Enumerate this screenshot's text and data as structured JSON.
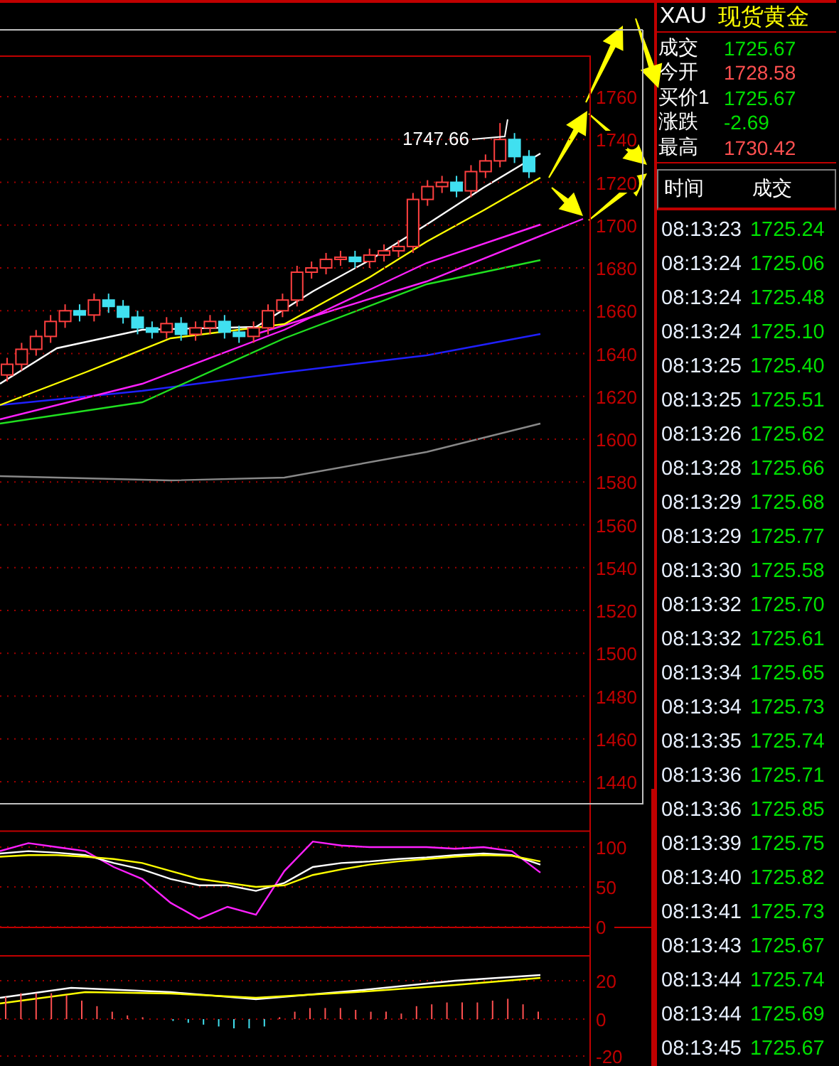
{
  "chart": {
    "high_label": "1747.66",
    "price_chart": {
      "chart_data": {
        "type": "candlestick",
        "ylim": [
          1440,
          1760
        ],
        "grid": true,
        "yticks": [
          1760,
          1740,
          1720,
          1700,
          1680,
          1660,
          1640,
          1620,
          1600,
          1580,
          1560,
          1540,
          1520,
          1500,
          1480,
          1460,
          1440
        ],
        "ohlc": [
          [
            1630,
            1638,
            1627,
            1635
          ],
          [
            1635,
            1645,
            1632,
            1642
          ],
          [
            1642,
            1651,
            1639,
            1648
          ],
          [
            1648,
            1658,
            1645,
            1655
          ],
          [
            1655,
            1663,
            1652,
            1660
          ],
          [
            1660,
            1663,
            1655,
            1658
          ],
          [
            1658,
            1668,
            1655,
            1665
          ],
          [
            1665,
            1668,
            1659,
            1662
          ],
          [
            1662,
            1665,
            1654,
            1657
          ],
          [
            1657,
            1660,
            1649,
            1652
          ],
          [
            1652,
            1655,
            1647,
            1650
          ],
          [
            1650,
            1657,
            1647,
            1654
          ],
          [
            1654,
            1657,
            1646,
            1649
          ],
          [
            1649,
            1655,
            1646,
            1652
          ],
          [
            1652,
            1658,
            1649,
            1655
          ],
          [
            1655,
            1658,
            1647,
            1650
          ],
          [
            1650,
            1653,
            1645,
            1648
          ],
          [
            1648,
            1655,
            1645,
            1652
          ],
          [
            1652,
            1663,
            1649,
            1660
          ],
          [
            1660,
            1668,
            1657,
            1665
          ],
          [
            1665,
            1681,
            1662,
            1678
          ],
          [
            1678,
            1683,
            1675,
            1680
          ],
          [
            1680,
            1687,
            1677,
            1684
          ],
          [
            1684,
            1688,
            1681,
            1685
          ],
          [
            1685,
            1688,
            1680,
            1683
          ],
          [
            1683,
            1689,
            1680,
            1686
          ],
          [
            1686,
            1691,
            1683,
            1688
          ],
          [
            1688,
            1693,
            1685,
            1690
          ],
          [
            1690,
            1715,
            1687,
            1712
          ],
          [
            1712,
            1721,
            1709,
            1718
          ],
          [
            1718,
            1723,
            1715,
            1720
          ],
          [
            1720,
            1723,
            1713,
            1716
          ],
          [
            1716,
            1728,
            1713,
            1725
          ],
          [
            1725,
            1733,
            1722,
            1730
          ],
          [
            1730,
            1747.66,
            1727,
            1740
          ],
          [
            1740,
            1743,
            1729,
            1732
          ],
          [
            1732,
            1735,
            1722,
            1725
          ]
        ]
      }
    },
    "kdj_chart": {
      "chart_data": {
        "type": "line",
        "ylim": [
          0,
          120
        ],
        "grid": true,
        "yticks": [
          100,
          50,
          0
        ],
        "series": [
          {
            "color": "#ff20ff",
            "values": [
              95,
              105,
              100,
              95,
              75,
              60,
              30,
              10,
              25,
              15,
              70,
              107,
              102,
              100,
              100,
              100,
              98,
              100,
              95,
              68
            ]
          },
          {
            "color": "#ffffff",
            "values": [
              92,
              95,
              93,
              90,
              80,
              72,
              60,
              52,
              52,
              45,
              55,
              75,
              80,
              82,
              85,
              87,
              90,
              92,
              90,
              78
            ]
          },
          {
            "color": "#ffff00",
            "values": [
              88,
              90,
              90,
              88,
              85,
              80,
              70,
              60,
              55,
              50,
              52,
              65,
              72,
              78,
              82,
              85,
              88,
              90,
              89,
              82
            ]
          }
        ]
      }
    },
    "macd_axis": [
      "20",
      "0",
      "-20"
    ]
  },
  "quote": {
    "symbol": "XAU",
    "name": "现货黄金",
    "fields": [
      {
        "label": "成交",
        "value": "1725.67",
        "color": "#00e000"
      },
      {
        "label": "今开",
        "value": "1728.58",
        "color": "#ff5050"
      },
      {
        "label": "买价1",
        "value": "1725.67",
        "color": "#00e000"
      },
      {
        "label": "涨跌",
        "value": "-2.69",
        "color": "#00e000"
      },
      {
        "label": "最高",
        "value": "1730.42",
        "color": "#ff5050"
      }
    ]
  },
  "trades": {
    "columns": [
      "时间",
      "成交"
    ],
    "rows": [
      {
        "time": "08:13:23",
        "price": "1725.24"
      },
      {
        "time": "08:13:24",
        "price": "1725.06"
      },
      {
        "time": "08:13:24",
        "price": "1725.48"
      },
      {
        "time": "08:13:24",
        "price": "1725.10"
      },
      {
        "time": "08:13:25",
        "price": "1725.40"
      },
      {
        "time": "08:13:25",
        "price": "1725.51"
      },
      {
        "time": "08:13:26",
        "price": "1725.62"
      },
      {
        "time": "08:13:28",
        "price": "1725.66"
      },
      {
        "time": "08:13:29",
        "price": "1725.68"
      },
      {
        "time": "08:13:29",
        "price": "1725.77"
      },
      {
        "time": "08:13:30",
        "price": "1725.58"
      },
      {
        "time": "08:13:32",
        "price": "1725.70"
      },
      {
        "time": "08:13:32",
        "price": "1725.61"
      },
      {
        "time": "08:13:34",
        "price": "1725.65"
      },
      {
        "time": "08:13:34",
        "price": "1725.73"
      },
      {
        "time": "08:13:35",
        "price": "1725.74"
      },
      {
        "time": "08:13:36",
        "price": "1725.71"
      },
      {
        "time": "08:13:36",
        "price": "1725.85"
      },
      {
        "time": "08:13:39",
        "price": "1725.75"
      },
      {
        "time": "08:13:40",
        "price": "1725.82"
      },
      {
        "time": "08:13:41",
        "price": "1725.73"
      },
      {
        "time": "08:13:43",
        "price": "1725.67"
      },
      {
        "time": "08:13:44",
        "price": "1725.74"
      },
      {
        "time": "08:13:44",
        "price": "1725.69"
      },
      {
        "time": "08:13:45",
        "price": "1725.67"
      }
    ]
  }
}
